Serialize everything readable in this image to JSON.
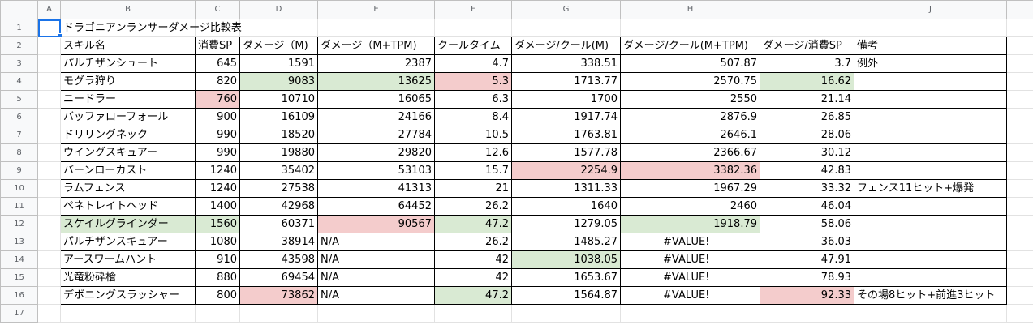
{
  "columns": [
    "A",
    "B",
    "C",
    "D",
    "E",
    "F",
    "G",
    "H",
    "I",
    "J"
  ],
  "title": "ドラゴニアンランサーダメージ比較表",
  "headers": [
    "スキル名",
    "消費SP",
    "ダメージ（M)",
    "ダメージ（M+TPM)",
    "クールタイム",
    "ダメージ/クール(M)",
    "ダメージ/クール(M+TPM)",
    "ダメージ/消費SP",
    "備考"
  ],
  "rows": [
    {
      "cells": [
        "パルチザンシュート",
        "645",
        "1591",
        "2387",
        "4.7",
        "338.51",
        "507.87",
        "3.7",
        "例外"
      ],
      "hl": [
        "",
        "",
        "",
        "",
        "",
        "",
        "",
        "",
        ""
      ]
    },
    {
      "cells": [
        "モグラ狩り",
        "820",
        "9083",
        "13625",
        "5.3",
        "1713.77",
        "2570.75",
        "16.62",
        ""
      ],
      "hl": [
        "",
        "",
        "g",
        "g",
        "r",
        "",
        "",
        "g",
        ""
      ]
    },
    {
      "cells": [
        "ニードラー",
        "760",
        "10710",
        "16065",
        "6.3",
        "1700",
        "2550",
        "21.14",
        ""
      ],
      "hl": [
        "",
        "r",
        "",
        "",
        "",
        "",
        "",
        "",
        ""
      ]
    },
    {
      "cells": [
        "バッファローフォール",
        "900",
        "16109",
        "24166",
        "8.4",
        "1917.74",
        "2876.9",
        "26.85",
        ""
      ],
      "hl": [
        "",
        "",
        "",
        "",
        "",
        "",
        "",
        "",
        ""
      ]
    },
    {
      "cells": [
        "ドリリングネック",
        "990",
        "18520",
        "27784",
        "10.5",
        "1763.81",
        "2646.1",
        "28.06",
        ""
      ],
      "hl": [
        "",
        "",
        "",
        "",
        "",
        "",
        "",
        "",
        ""
      ]
    },
    {
      "cells": [
        "ウイングスキュアー",
        "990",
        "19880",
        "29820",
        "12.6",
        "1577.78",
        "2366.67",
        "30.12",
        ""
      ],
      "hl": [
        "",
        "",
        "",
        "",
        "",
        "",
        "",
        "",
        ""
      ]
    },
    {
      "cells": [
        "バーンローカスト",
        "1240",
        "35402",
        "53103",
        "15.7",
        "2254.9",
        "3382.36",
        "42.83",
        ""
      ],
      "hl": [
        "",
        "",
        "",
        "",
        "",
        "r",
        "r",
        "",
        ""
      ]
    },
    {
      "cells": [
        "ラムフェンス",
        "1240",
        "27538",
        "41313",
        "21",
        "1311.33",
        "1967.29",
        "33.32",
        "フェンス11ヒット+爆発"
      ],
      "hl": [
        "",
        "",
        "",
        "",
        "",
        "",
        "",
        "",
        ""
      ]
    },
    {
      "cells": [
        "ペネトレイトヘッド",
        "1400",
        "42968",
        "64452",
        "26.2",
        "1640",
        "2460",
        "46.04",
        ""
      ],
      "hl": [
        "",
        "",
        "",
        "",
        "",
        "",
        "",
        "",
        ""
      ]
    },
    {
      "cells": [
        "スケイルグラインダー",
        "1560",
        "60371",
        "90567",
        "47.2",
        "1279.05",
        "1918.79",
        "58.06",
        ""
      ],
      "hl": [
        "g",
        "g",
        "",
        "r",
        "g",
        "",
        "g",
        "",
        ""
      ]
    },
    {
      "cells": [
        "パルチザンスキュアー",
        "1080",
        "38914",
        "N/A",
        "26.2",
        "1485.27",
        "#VALUE!",
        "36.03",
        ""
      ],
      "hl": [
        "",
        "",
        "",
        "",
        "",
        "",
        "",
        "",
        ""
      ]
    },
    {
      "cells": [
        "アースワームハント",
        "910",
        "43598",
        "N/A",
        "42",
        "1038.05",
        "#VALUE!",
        "47.91",
        ""
      ],
      "hl": [
        "",
        "",
        "",
        "",
        "",
        "g",
        "",
        "",
        ""
      ]
    },
    {
      "cells": [
        "光竜粉砕槍",
        "880",
        "69454",
        "N/A",
        "42",
        "1653.67",
        "#VALUE!",
        "78.93",
        ""
      ],
      "hl": [
        "",
        "",
        "",
        "",
        "",
        "",
        "",
        "",
        ""
      ]
    },
    {
      "cells": [
        "デボニングスラッシャー",
        "800",
        "73862",
        "N/A",
        "47.2",
        "1564.87",
        "#VALUE!",
        "92.33",
        "その場8ヒット+前進3ヒット"
      ],
      "hl": [
        "",
        "",
        "r",
        "",
        "g",
        "",
        "",
        "r",
        ""
      ]
    }
  ]
}
